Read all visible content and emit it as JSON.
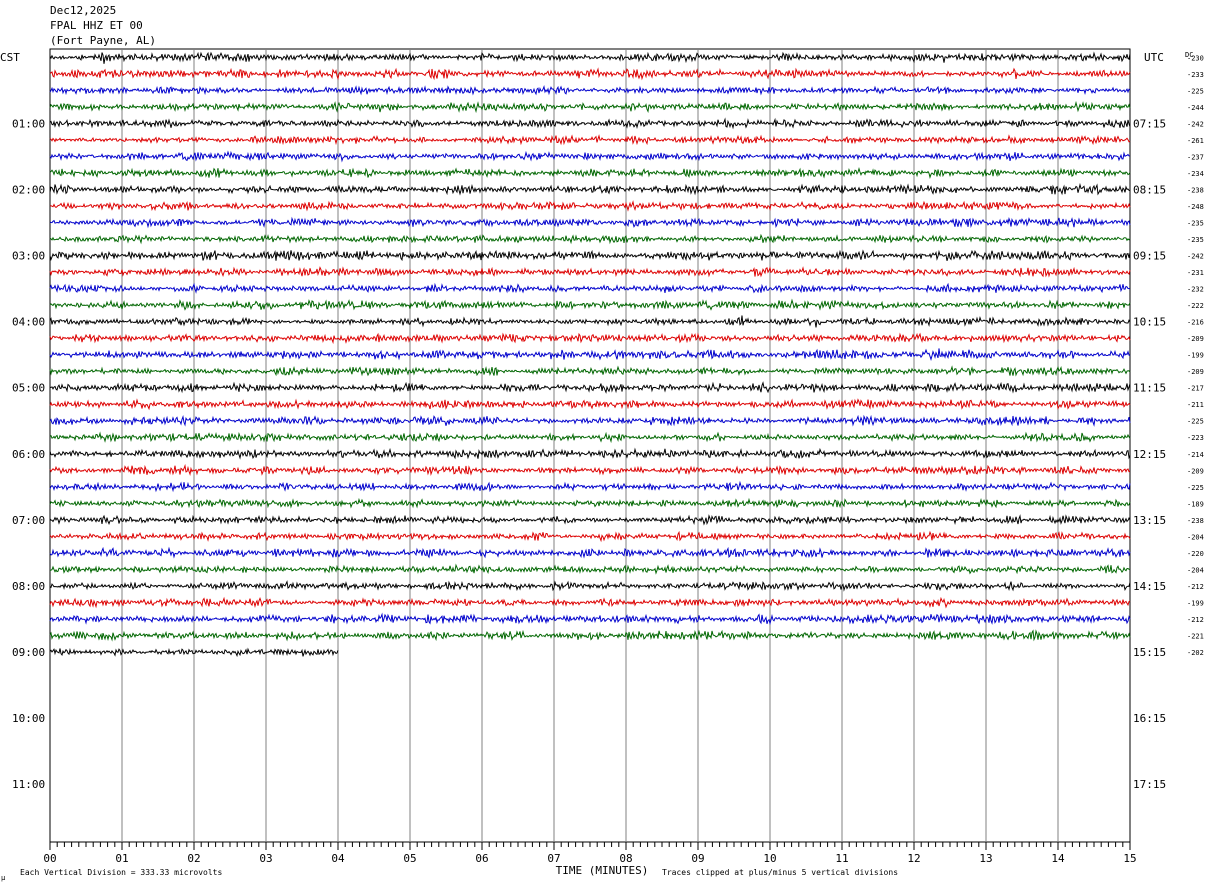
{
  "header": {
    "date": "Dec12,2025",
    "station": "FPAL HHZ ET 00",
    "location": "(Fort Payne, AL)"
  },
  "labels": {
    "left_tz": "CST",
    "right_tz": "UTC",
    "dc": "DC",
    "x_axis": "TIME (MINUTES)",
    "scale_note": "Each Vertical Division =  333.33 microvolts",
    "clip_note": "Traces clipped at plus/minus 5 vertical divisions",
    "corner_mark": "µ"
  },
  "chart_data": {
    "type": "line",
    "title": "",
    "xlabel": "TIME (MINUTES)",
    "xlim": [
      0,
      15
    ],
    "x_ticks": [
      "00",
      "01",
      "02",
      "03",
      "04",
      "05",
      "06",
      "07",
      "08",
      "09",
      "10",
      "11",
      "12",
      "13",
      "14",
      "15"
    ],
    "left_hour_labels": [
      "01:00",
      "02:00",
      "03:00",
      "04:00",
      "05:00",
      "06:00",
      "07:00",
      "08:00",
      "09:00",
      "10:00",
      "11:00"
    ],
    "right_hour_labels": [
      "07:15",
      "08:15",
      "09:15",
      "10:15",
      "11:15",
      "12:15",
      "13:15",
      "14:15",
      "15:15",
      "16:15",
      "17:15"
    ],
    "row_count": 48,
    "trace_colors": [
      "#000000",
      "#dd0000",
      "#0000cc",
      "#006600"
    ],
    "dc_offsets": [
      -230,
      -233,
      -225,
      -244,
      -242,
      -261,
      -237,
      -234,
      -238,
      -248,
      -235,
      -235,
      -242,
      -231,
      -232,
      -222,
      -216,
      -209,
      -199,
      -209,
      -217,
      -211,
      -225,
      -223,
      -214,
      -209,
      -225,
      -189,
      -238,
      -204,
      -220,
      -204,
      -212,
      -199,
      -212,
      -221,
      -202
    ],
    "traces_complete": 36,
    "last_trace_end_minute": 4.0
  }
}
